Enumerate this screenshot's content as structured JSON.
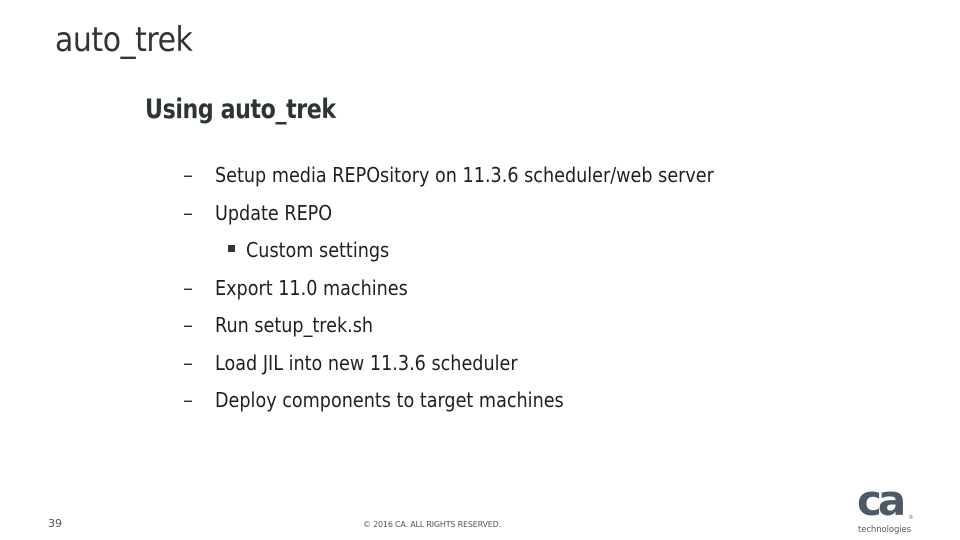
{
  "slide": {
    "title": "auto_trek",
    "subtitle": "Using auto_trek",
    "bullets": [
      {
        "marker": "–",
        "level": 1,
        "text": "Setup media REPOsitory on 11.3.6 scheduler/web server"
      },
      {
        "marker": "–",
        "level": 1,
        "text": "Update REPO"
      },
      {
        "marker": "square",
        "level": 2,
        "text": "Custom settings"
      },
      {
        "marker": "–",
        "level": 1,
        "text": "Export 11.0 machines"
      },
      {
        "marker": "–",
        "level": 1,
        "text": "Run setup_trek.sh"
      },
      {
        "marker": "–",
        "level": 1,
        "text": "Load JIL into new 11.3.6 scheduler"
      },
      {
        "marker": "–",
        "level": 1,
        "text": "Deploy components to target machines"
      }
    ]
  },
  "footer": {
    "page_number": "39",
    "copyright": "© 2016 CA. ALL RIGHTS RESERVED.",
    "logo": {
      "mark": "ca",
      "registered": "®",
      "tagline": "technologies"
    }
  },
  "colors": {
    "title": "#333333",
    "logo": "#4e5b66"
  }
}
